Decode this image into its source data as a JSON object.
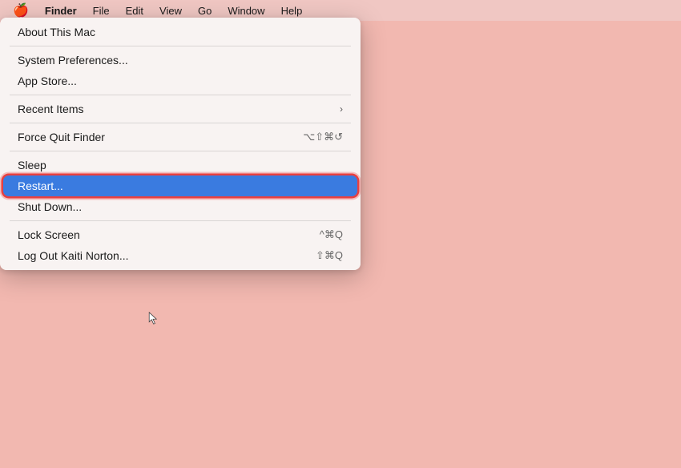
{
  "background_color": "#f2b8b0",
  "menubar": {
    "apple_icon": "🍎",
    "items": [
      {
        "id": "finder",
        "label": "Finder",
        "active": false,
        "bold": true
      },
      {
        "id": "file",
        "label": "File",
        "active": false
      },
      {
        "id": "edit",
        "label": "Edit",
        "active": false
      },
      {
        "id": "view",
        "label": "View",
        "active": false
      },
      {
        "id": "go",
        "label": "Go",
        "active": false
      },
      {
        "id": "window",
        "label": "Window",
        "active": false
      },
      {
        "id": "help",
        "label": "Help",
        "active": false
      }
    ]
  },
  "dropdown": {
    "items": [
      {
        "id": "about-mac",
        "label": "About This Mac",
        "shortcut": "",
        "separator_after": true,
        "has_submenu": false,
        "highlighted": false
      },
      {
        "id": "system-preferences",
        "label": "System Preferences...",
        "shortcut": "",
        "separator_after": false,
        "has_submenu": false,
        "highlighted": false
      },
      {
        "id": "app-store",
        "label": "App Store...",
        "shortcut": "",
        "separator_after": true,
        "has_submenu": false,
        "highlighted": false
      },
      {
        "id": "recent-items",
        "label": "Recent Items",
        "shortcut": "",
        "separator_after": true,
        "has_submenu": true,
        "highlighted": false
      },
      {
        "id": "force-quit",
        "label": "Force Quit Finder",
        "shortcut": "⌥⇧⌘⊙",
        "separator_after": true,
        "has_submenu": false,
        "highlighted": false
      },
      {
        "id": "sleep",
        "label": "Sleep",
        "shortcut": "",
        "separator_after": false,
        "has_submenu": false,
        "highlighted": false
      },
      {
        "id": "restart",
        "label": "Restart...",
        "shortcut": "",
        "separator_after": false,
        "has_submenu": false,
        "highlighted": true
      },
      {
        "id": "shut-down",
        "label": "Shut Down...",
        "shortcut": "",
        "separator_after": true,
        "has_submenu": false,
        "highlighted": false
      },
      {
        "id": "lock-screen",
        "label": "Lock Screen",
        "shortcut": "^⌘Q",
        "separator_after": false,
        "has_submenu": false,
        "highlighted": false
      },
      {
        "id": "log-out",
        "label": "Log Out Kaiti Norton...",
        "shortcut": "⇧⌘Q",
        "separator_after": false,
        "has_submenu": false,
        "highlighted": false
      }
    ]
  }
}
